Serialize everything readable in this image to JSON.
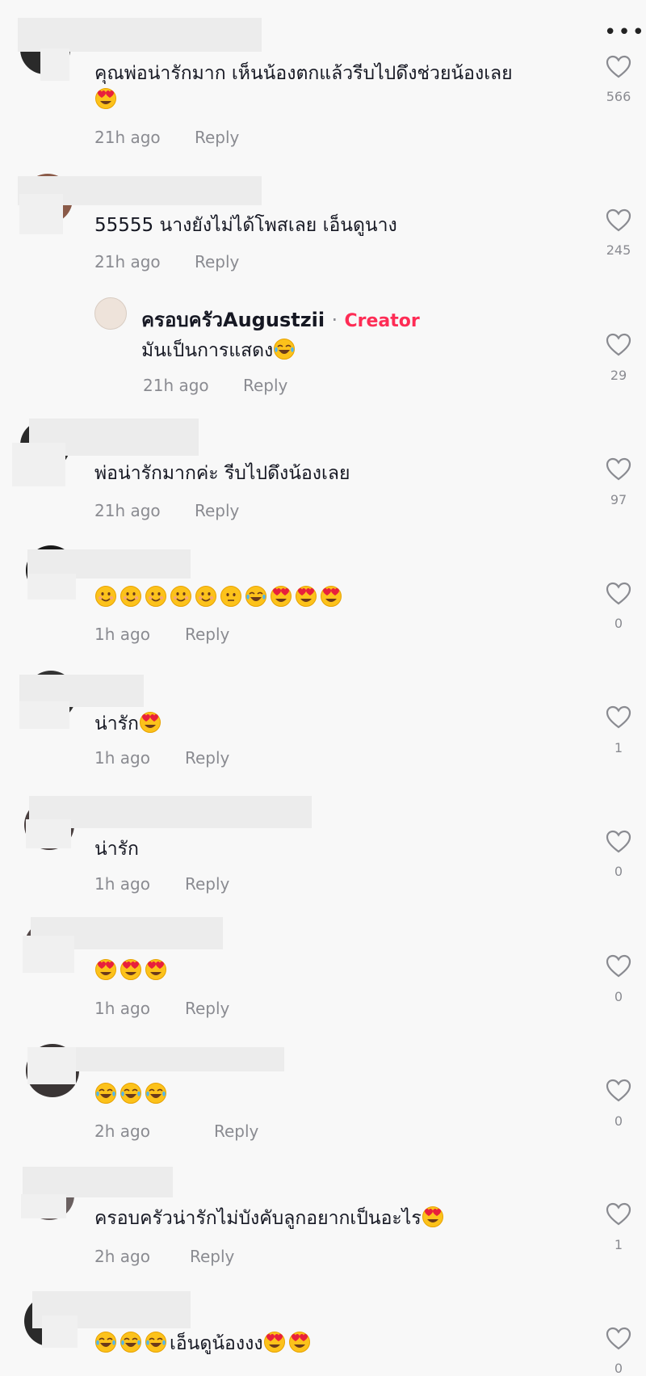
{
  "more_label": "•••",
  "comments": [
    {
      "text": "คุณพ่อน่ารักมาก เห็นน้องตกแล้วรีบไปดึงช่วยน้องเลย",
      "emojis": [
        "heart-eyes"
      ],
      "time": "21h ago",
      "reply": "Reply",
      "likes": "566"
    },
    {
      "text": "55555 นางยังไม่ได้โพสเลย เอ็นดูนาง",
      "emojis": [],
      "time": "21h ago",
      "reply": "Reply",
      "likes": "245"
    },
    {
      "text": "พ่อน่ารักมากค่ะ รีบไปดึงน้องเลย",
      "emojis": [],
      "time": "21h ago",
      "reply": "Reply",
      "likes": "97"
    },
    {
      "text": "",
      "emojis": [
        "smile",
        "smile",
        "smile",
        "smile",
        "smile",
        "neutral",
        "tears",
        "heart-eyes",
        "heart-eyes",
        "heart-eyes"
      ],
      "time": "1h ago",
      "reply": "Reply",
      "likes": "0"
    },
    {
      "text": "น่ารัก",
      "emojis": [
        "heart-eyes"
      ],
      "time": "1h ago",
      "reply": "Reply",
      "likes": "1"
    },
    {
      "text": "น่ารัก",
      "emojis": [],
      "time": "1h ago",
      "reply": "Reply",
      "likes": "0"
    },
    {
      "text": "",
      "emojis": [
        "heart-eyes",
        "heart-eyes",
        "heart-eyes"
      ],
      "time": "1h ago",
      "reply": "Reply",
      "likes": "0"
    },
    {
      "text": "",
      "emojis": [
        "tears",
        "tears",
        "tears"
      ],
      "time": "2h ago",
      "reply": "Reply",
      "likes": "0"
    },
    {
      "text": "ครอบครัวน่ารักไม่บังคับลูกอยากเป็นอะไร",
      "emojis": [
        "heart-eyes"
      ],
      "time": "2h ago",
      "reply": "Reply",
      "likes": "1"
    },
    {
      "text": "เอ็นดูน้องงง",
      "emojis_before": [
        "tears",
        "tears",
        "tears"
      ],
      "emojis": [
        "heart-eyes",
        "heart-eyes"
      ],
      "time": "",
      "reply": "",
      "likes": "0"
    }
  ],
  "creator_reply": {
    "name": "ครอบครัวAugustzii",
    "separator": "·",
    "badge": "Creator",
    "text": "มันเป็นการแสดง",
    "emojis": [
      "tears"
    ],
    "time": "21h ago",
    "reply": "Reply",
    "likes": "29"
  },
  "colors": {
    "creator_badge": "#fe2c55",
    "meta": "#8a8b91",
    "text": "#161823"
  }
}
